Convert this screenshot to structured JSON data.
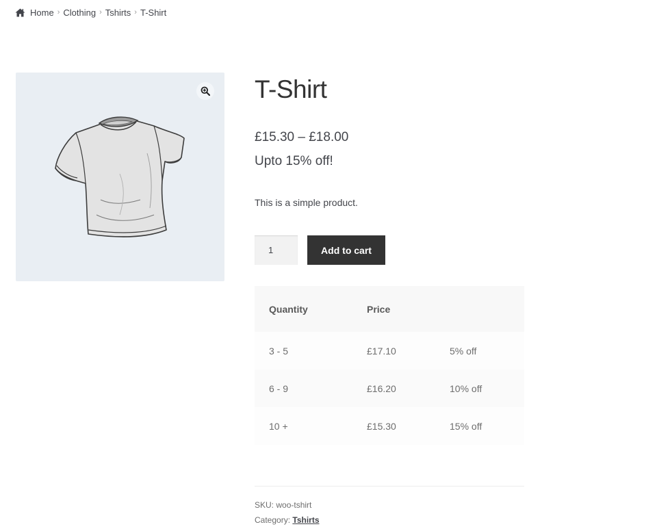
{
  "breadcrumb": {
    "items": [
      "Home",
      "Clothing",
      "Tshirts",
      "T-Shirt"
    ],
    "separator": "›"
  },
  "product": {
    "title": "T-Shirt",
    "price": "£15.30 – £18.00",
    "discount_note": "Upto 15% off!",
    "short_description": "This is a simple product.",
    "quantity_value": "1",
    "add_to_cart_label": "Add to cart",
    "image_icon": "tshirt-image",
    "zoom_icon": "zoom-in-icon"
  },
  "tier_table": {
    "headers": [
      "Quantity",
      "Price",
      ""
    ],
    "rows": [
      [
        "3 - 5",
        "£17.10",
        "5% off"
      ],
      [
        "6 - 9",
        "£16.20",
        "10% off"
      ],
      [
        "10 +",
        "£15.30",
        "15% off"
      ]
    ]
  },
  "meta": {
    "sku_label": "SKU:",
    "sku_value": "woo-tshirt",
    "category_label": "Category:",
    "category_value": "Tshirts"
  },
  "colors": {
    "button_bg": "#333333",
    "image_bg": "#e9eef3",
    "text": "#43454b"
  }
}
